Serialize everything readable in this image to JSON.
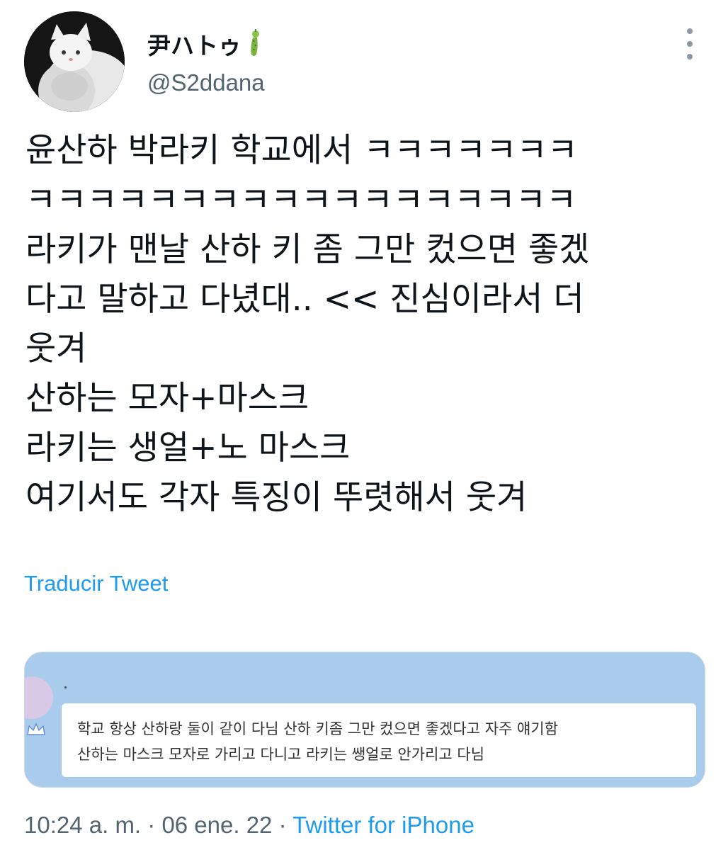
{
  "author": {
    "display_name": "尹ハトゥ",
    "handle": "@S2ddana",
    "avatar_icon": "white-cat-avatar",
    "badge_icon": "green-cucumber-emoji"
  },
  "tweet": {
    "lines": [
      "윤산하 박라키 학교에서 ㅋㅋㅋㅋㅋㅋㅋ",
      "ㅋㅋㅋㅋㅋㅋㅋㅋㅋㅋㅋㅋㅋㅋㅋㅋㅋㅋ",
      "라키가 맨날 산하 키 좀 그만 컸으면 좋겠",
      "다고 말하고 다녔대.. << 진심이라서 더",
      "웃겨",
      "산하는 모자+마스크",
      "라키는 생얼+노 마스크",
      "여기서도 각자 특징이 뚜렷해서 웃겨"
    ],
    "translate_label": "Traducir Tweet"
  },
  "media": {
    "bubble_lines": [
      "학교 항상 산하랑 둘이 같이 다님 산하 키좀 그만 컸으면 좋겠다고 자주 얘기함",
      "산하는 마스크 모자로 가리고 다니고 라키는 쌩얼로 안가리고 다님"
    ]
  },
  "meta": {
    "time": "10:24 a. m.",
    "separator": " · ",
    "date": "06 ene. 22",
    "source": "Twitter for iPhone"
  },
  "colors": {
    "accent": "#1d9bf0",
    "secondary_text": "#536471",
    "media_background": "#a9cbec"
  }
}
